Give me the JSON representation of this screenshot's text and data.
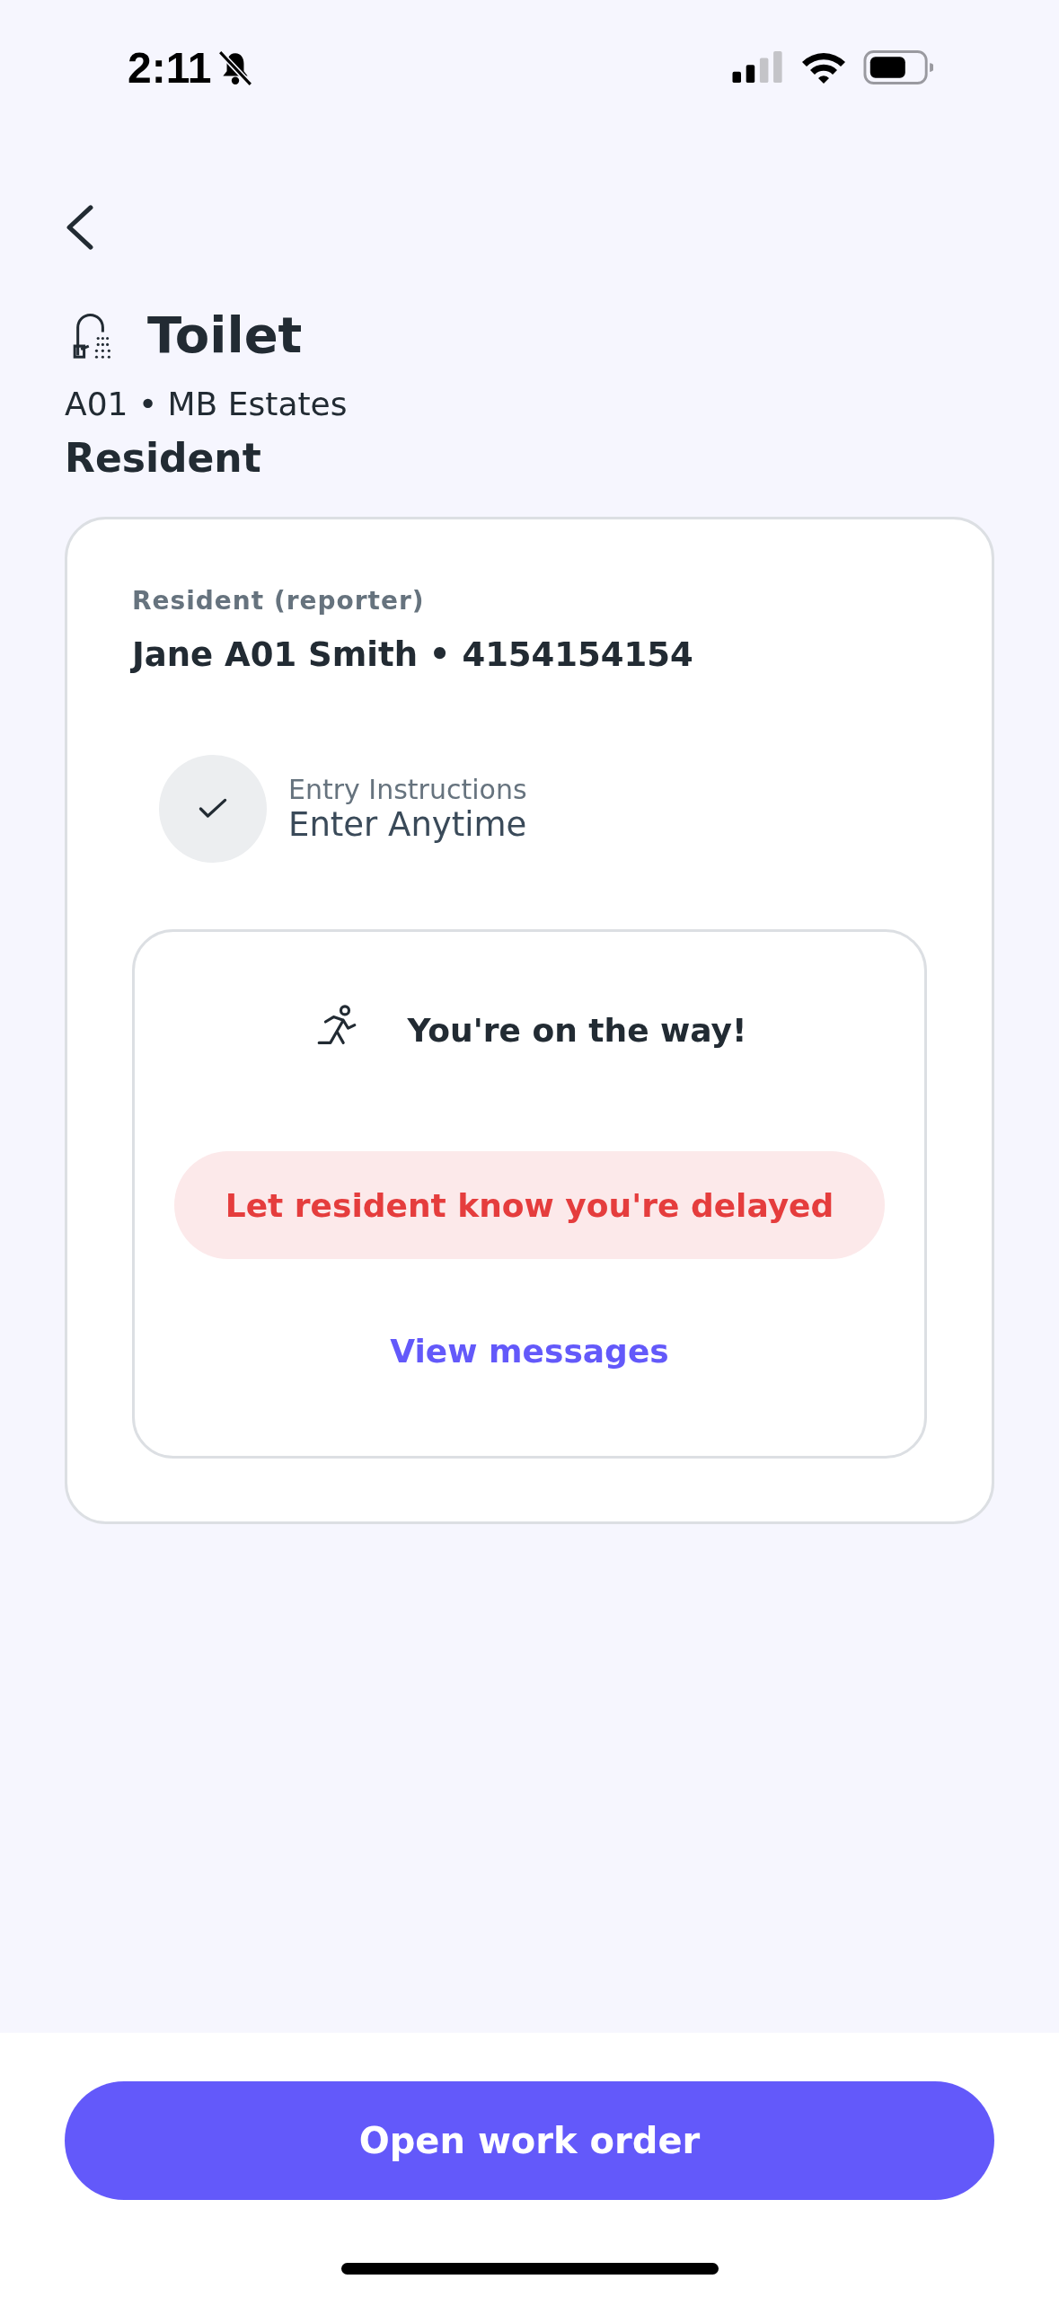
{
  "status_bar": {
    "time": "2:11",
    "silenced": true
  },
  "header": {
    "title": "Toilet",
    "subtitle": "A01 • MB Estates",
    "section": "Resident"
  },
  "reporter": {
    "label": "Resident (reporter)",
    "contact": "Jane A01 Smith • 4154154154"
  },
  "entry": {
    "label": "Entry Instructions",
    "value": "Enter Anytime",
    "checked": true
  },
  "trip": {
    "status": "You're on the way!",
    "delay_button": "Let resident know you're delayed",
    "messages_link": "View messages"
  },
  "primary_button": "Open work order"
}
